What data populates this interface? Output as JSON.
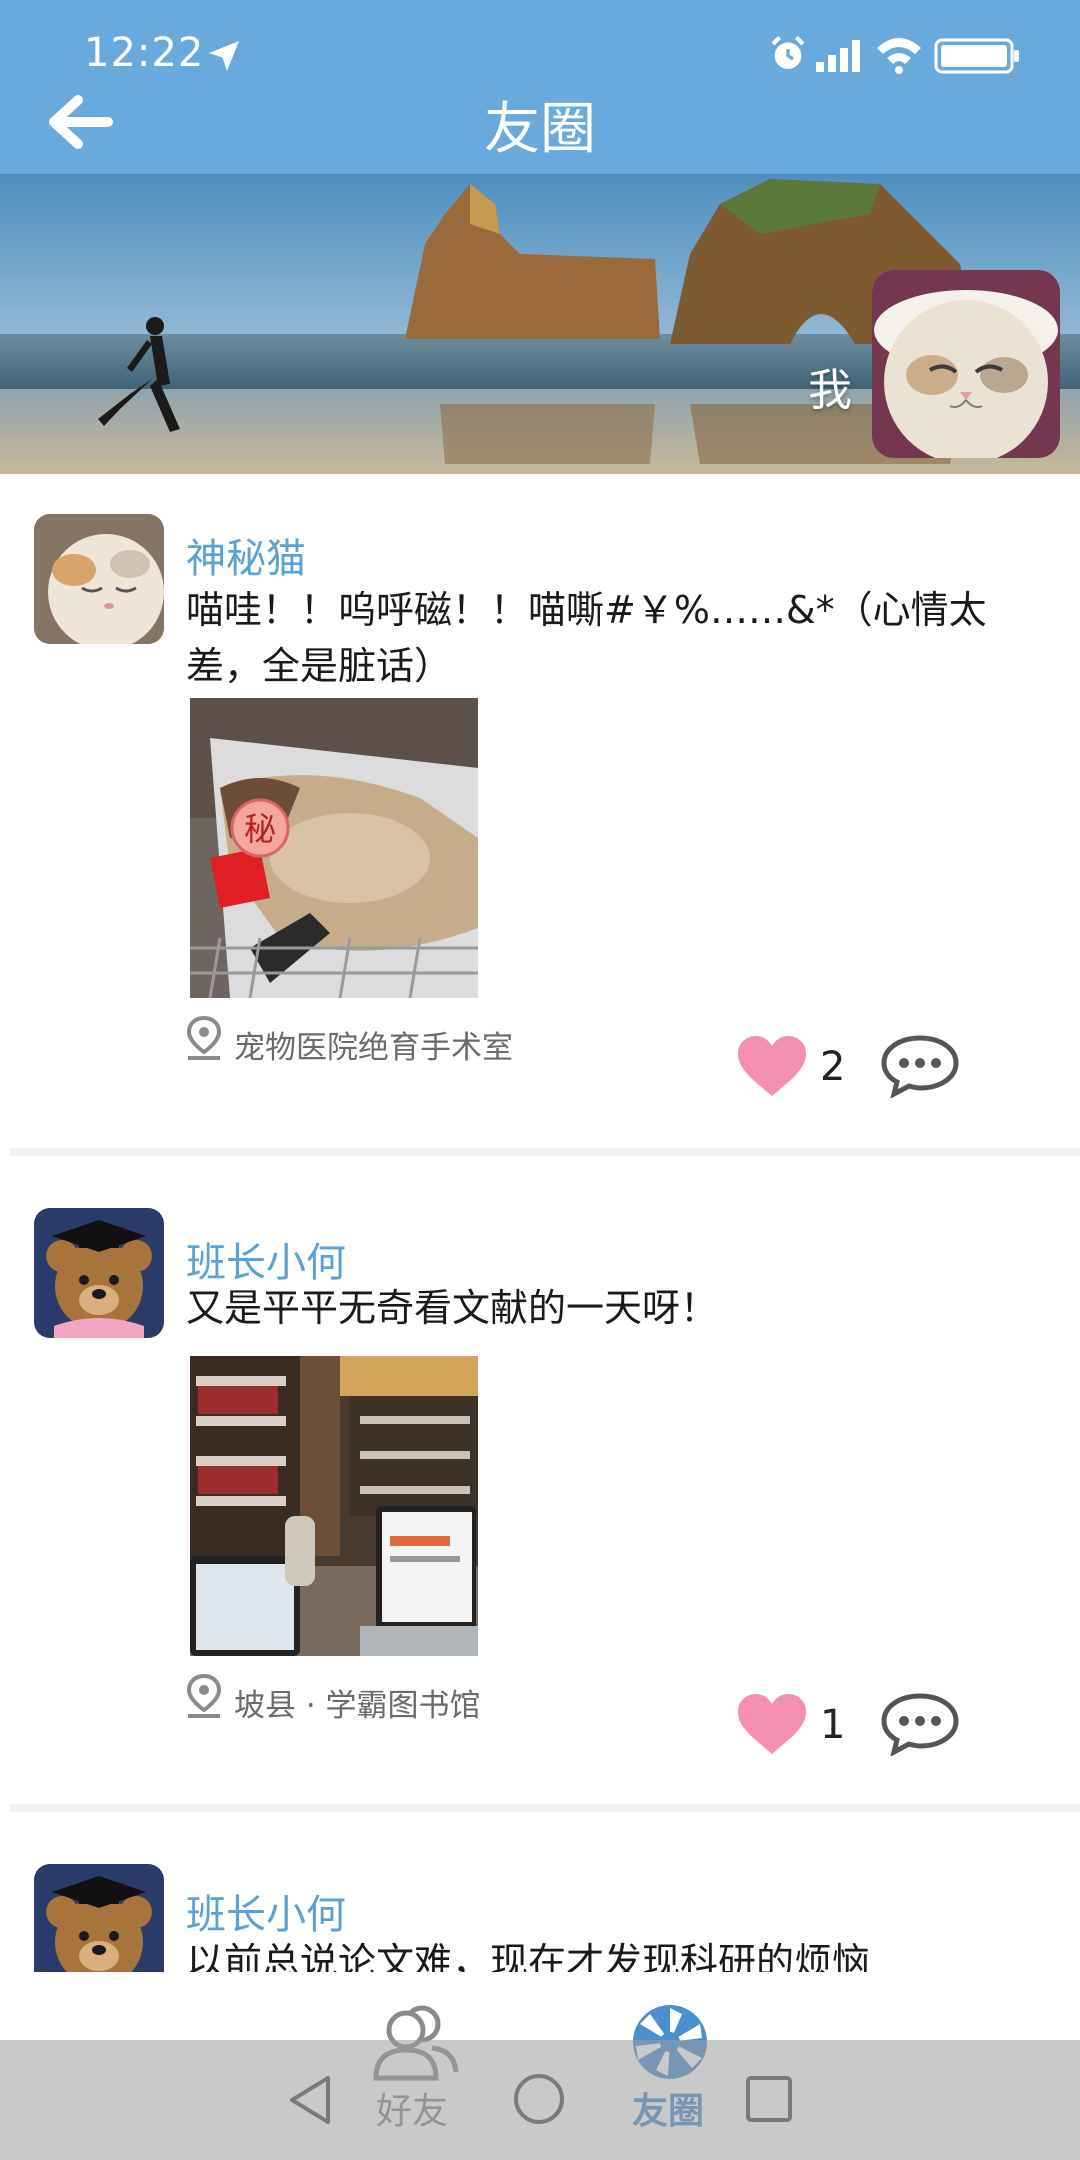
{
  "status_bar": {
    "time": "12:22",
    "icons": [
      "location-arrow-icon",
      "alarm-icon",
      "signal-icon",
      "wifi-icon",
      "battery-icon"
    ]
  },
  "header": {
    "title": "友圈",
    "back_icon": "arrow-left-icon"
  },
  "banner": {
    "me_label": "我"
  },
  "posts": [
    {
      "name": "神秘猫",
      "content": "喵哇！！呜呼磁！！喵嘶#￥%……&*（心情太差，全是脏话）",
      "location": "宠物医院绝育手术室",
      "likes": "2",
      "photo_badge": "秘"
    },
    {
      "name": "班长小何",
      "content": "又是平平无奇看文献的一天呀！",
      "location": "坡县 · 学霸图书馆",
      "likes": "1"
    },
    {
      "name": "班长小何",
      "content": "以前总说论文难，现在才发现科研的烦恼"
    }
  ],
  "tabs": [
    {
      "label": "好友",
      "icon": "friends-icon",
      "active": false
    },
    {
      "label": "友圈",
      "icon": "moments-icon",
      "active": true
    }
  ],
  "colors": {
    "header": "#6aa9db",
    "name": "#5aa1d6",
    "like": "#f58fb1",
    "tab_active": "#4a8fd0",
    "tab_inactive": "#8a8a8a"
  }
}
